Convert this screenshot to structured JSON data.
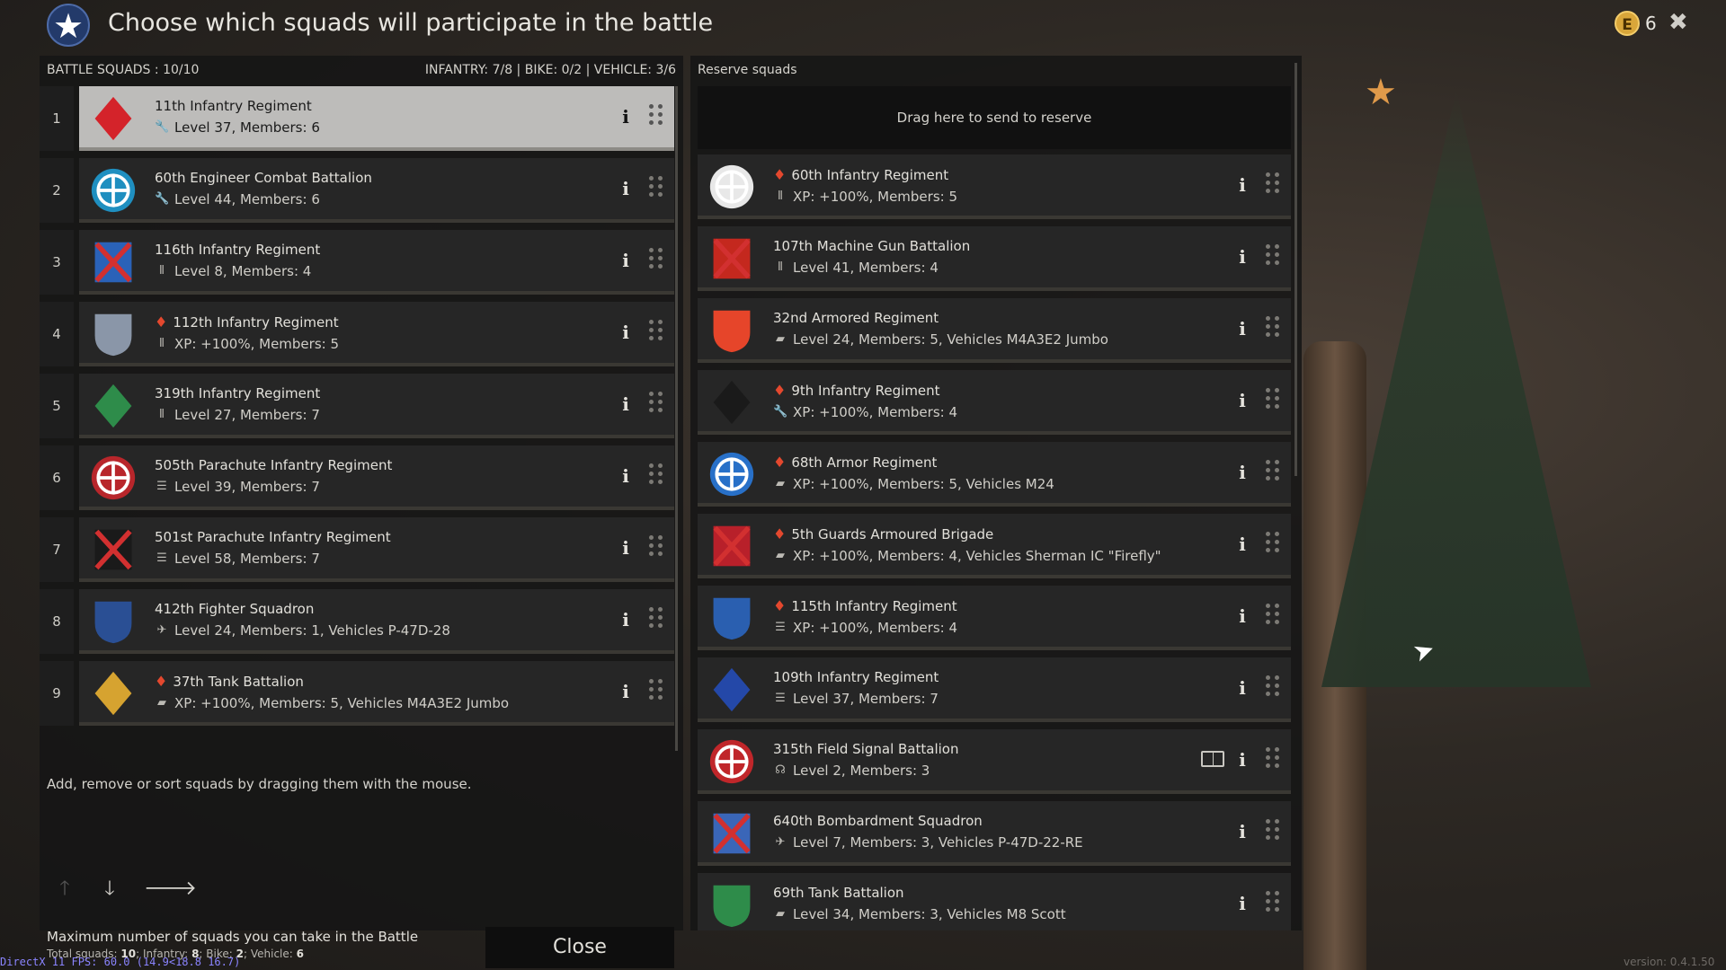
{
  "header": {
    "title": "Choose which squads will participate in the battle",
    "currency_symbol": "E",
    "currency_count": "6"
  },
  "battle": {
    "label": "BATTLE SQUADS : 10/10",
    "limits": "INFANTRY: 7/8 | BIKE: 0/2 | VEHICLE: 3/6",
    "squads": [
      {
        "slot": "1",
        "name": "11th Infantry Regiment",
        "info": "Level 37, Members: 6",
        "type_icon": "wrench-icon",
        "premium": false,
        "selected": true,
        "emblem_color": "#d4232a"
      },
      {
        "slot": "2",
        "name": "60th Engineer Combat Battalion",
        "info": "Level 44, Members: 6",
        "type_icon": "wrench-icon",
        "premium": false,
        "emblem_color": "#1f8fc0"
      },
      {
        "slot": "3",
        "name": "116th Infantry Regiment",
        "info": "Level 8, Members: 4",
        "type_icon": "rifles-icon",
        "premium": false,
        "emblem_color": "#2a62b8"
      },
      {
        "slot": "4",
        "name": "112th Infantry Regiment",
        "info": "XP: +100%, Members: 5",
        "type_icon": "rifles-icon",
        "premium": true,
        "emblem_color": "#8a96a8"
      },
      {
        "slot": "5",
        "name": "319th Infantry Regiment",
        "info": "Level 27, Members: 7",
        "type_icon": "rifles-icon",
        "premium": false,
        "emblem_color": "#2e8c4a"
      },
      {
        "slot": "6",
        "name": "505th Parachute Infantry Regiment",
        "info": "Level 39, Members: 7",
        "type_icon": "list-icon",
        "premium": false,
        "emblem_color": "#b8262b"
      },
      {
        "slot": "7",
        "name": "501st Parachute Infantry Regiment",
        "info": "Level 58, Members: 7",
        "type_icon": "list-icon",
        "premium": false,
        "emblem_color": "#1a1a1a"
      },
      {
        "slot": "8",
        "name": "412th Fighter Squadron",
        "info": "Level 24, Members: 1, Vehicles P-47D-28",
        "type_icon": "planes-icon",
        "premium": false,
        "emblem_color": "#2a4f94"
      },
      {
        "slot": "9",
        "name": "37th Tank Battalion",
        "info": "XP: +100%, Members: 5, Vehicles M4A3E2 Jumbo",
        "type_icon": "tank-icon",
        "premium": true,
        "emblem_color": "#d6a330"
      }
    ]
  },
  "hint": "Add, remove or sort squads by dragging them with the mouse.",
  "max_title": "Maximum number of squads you can take in the Battle",
  "max_sub": {
    "total_label": "Total squads:",
    "total": "10",
    "infantry_label": "; Infantry:",
    "infantry": "8",
    "bike_label": "; Bike:",
    "bike": "2",
    "vehicle_label": "; Vehicle:",
    "vehicle": "6"
  },
  "close_label": "Close",
  "reserve": {
    "label": "Reserve squads",
    "drop_hint": "Drag here to send to reserve",
    "squads": [
      {
        "name": "60th Infantry Regiment",
        "info": "XP: +100%, Members: 5",
        "type_icon": "rifles-icon",
        "premium": true,
        "emblem_color": "#e8e8e8"
      },
      {
        "name": "107th Machine Gun Battalion",
        "info": "Level 41, Members: 4",
        "type_icon": "rifles-icon",
        "premium": false,
        "emblem_color": "#c4281e"
      },
      {
        "name": "32nd Armored Regiment",
        "info": "Level 24, Members: 5, Vehicles M4A3E2 Jumbo",
        "type_icon": "tank-icon",
        "premium": false,
        "emblem_color": "#e6452a"
      },
      {
        "name": "9th Infantry Regiment",
        "info": "XP: +100%, Members: 4",
        "type_icon": "wrench-icon",
        "premium": true,
        "emblem_color": "#1a1a1a"
      },
      {
        "name": "68th Armor Regiment",
        "info": "XP: +100%, Members: 5, Vehicles M24",
        "type_icon": "tank-icon",
        "premium": true,
        "emblem_color": "#2870c8"
      },
      {
        "name": "5th Guards Armoured Brigade",
        "info": "XP: +100%, Members: 4, Vehicles Sherman IC \"Firefly\"",
        "type_icon": "tank-icon",
        "premium": true,
        "emblem_color": "#b8202a"
      },
      {
        "name": "115th Infantry Regiment",
        "info": "XP: +100%, Members: 4",
        "type_icon": "list-icon",
        "premium": true,
        "emblem_color": "#2a5fb0"
      },
      {
        "name": "109th Infantry Regiment",
        "info": "Level 37, Members: 7",
        "type_icon": "list-icon",
        "premium": false,
        "emblem_color": "#2448a8"
      },
      {
        "name": "315th Field Signal Battalion",
        "info": "Level 2, Members: 3",
        "type_icon": "headphones-icon",
        "premium": false,
        "has_book": true,
        "emblem_color": "#c0262a"
      },
      {
        "name": "640th Bombardment Squadron",
        "info": "Level 7, Members: 3, Vehicles P-47D-22-RE",
        "type_icon": "planes-icon",
        "premium": false,
        "emblem_color": "#3a66b8"
      },
      {
        "name": "69th Tank Battalion",
        "info": "Level 34, Members: 3, Vehicles M8 Scott",
        "type_icon": "tank-icon",
        "premium": false,
        "emblem_color": "#2e8c4a"
      }
    ]
  },
  "footer": {
    "fps": "DirectX 11 FPS: 60.0 (14.9<18.8 16.7)",
    "version": "version: 0.4.1.50"
  }
}
